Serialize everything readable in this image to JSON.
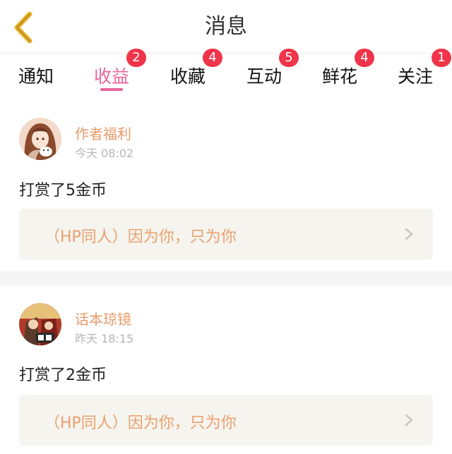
{
  "header": {
    "title": "消息"
  },
  "tabs": [
    {
      "label": "通知",
      "badge": ""
    },
    {
      "label": "收益",
      "badge": "2",
      "active": true
    },
    {
      "label": "收藏",
      "badge": "4"
    },
    {
      "label": "互动",
      "badge": "5"
    },
    {
      "label": "鲜花",
      "badge": "4"
    },
    {
      "label": "关注",
      "badge": "1"
    }
  ],
  "messages": [
    {
      "author": "作者福利",
      "time": "今天 08:02",
      "text": "打赏了5金币",
      "link": "（HP同人）因为你，只为你"
    },
    {
      "author": "话本琼镜",
      "time": "昨天 18:15",
      "text": "打赏了2金币",
      "link": "（HP同人）因为你，只为你"
    }
  ],
  "colors": {
    "accent": "#e8649c",
    "badge": "#f0344a",
    "author": "#e89a6a",
    "link": "#eaa06e",
    "link_bg": "#f6f4ee"
  },
  "icons": {
    "back": "chevron-left-icon",
    "link_arrow": "chevron-right-icon"
  }
}
